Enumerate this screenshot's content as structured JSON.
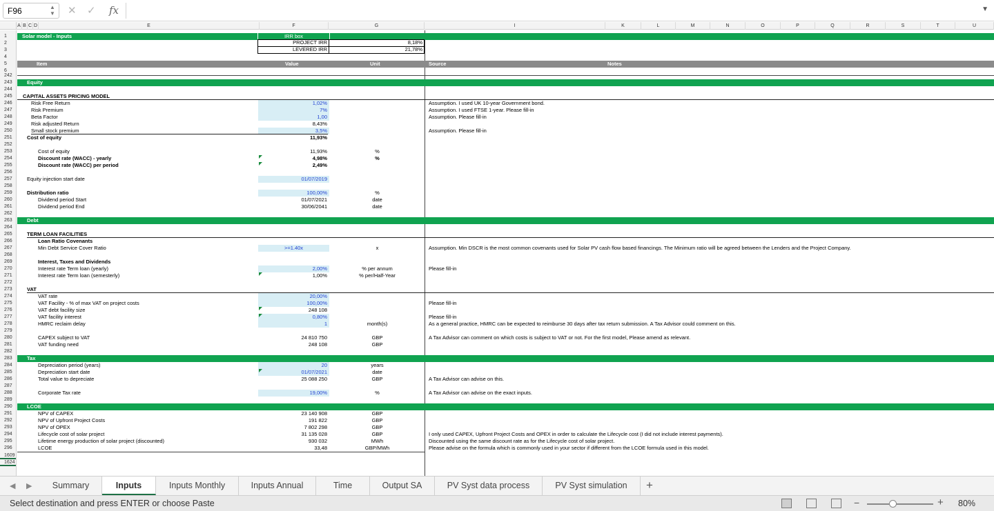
{
  "formula_bar": {
    "name_box": "F96",
    "fx_label": "fx",
    "formula": ""
  },
  "columns": [
    "A",
    "B",
    "C",
    "D",
    "E",
    "F",
    "G",
    "I",
    "K",
    "L",
    "M",
    "N",
    "O",
    "P",
    "Q",
    "R",
    "S",
    "T",
    "U"
  ],
  "row_numbers": [
    "1",
    "2",
    "3",
    "4",
    "5",
    "6",
    "242",
    "243",
    "244",
    "245",
    "246",
    "247",
    "248",
    "249",
    "250",
    "251",
    "252",
    "253",
    "254",
    "255",
    "256",
    "257",
    "258",
    "259",
    "260",
    "261",
    "262",
    "263",
    "264",
    "265",
    "266",
    "267",
    "268",
    "269",
    "270",
    "271",
    "272",
    "273",
    "274",
    "275",
    "276",
    "277",
    "278",
    "279",
    "280",
    "281",
    "282",
    "283",
    "284",
    "285",
    "286",
    "287",
    "288",
    "289",
    "290",
    "291",
    "292",
    "293",
    "294",
    "295",
    "296",
    "1609",
    "1624"
  ],
  "sheet": {
    "title": "Solar model - Inputs",
    "irr_box": {
      "header": "IRR box",
      "project_label": "PROJECT IRR",
      "project_value": "8,18%",
      "levered_label": "LEVERED IRR",
      "levered_value": "21,78%"
    },
    "header_row": {
      "item": "Item",
      "value": "Value",
      "unit": "Unit",
      "source": "Source",
      "notes": "Notes"
    },
    "equity": {
      "band": "Equity",
      "capm_title": "CAPITAL ASSETS PRICING MODEL",
      "rows": [
        {
          "label": "Risk Free Return",
          "value": "1,02%",
          "source": "Assumption. I used UK 10-year Government bond."
        },
        {
          "label": "Risk Premium",
          "value": "7%",
          "source": "Assumption. I used FTSE 1-year. Please fill-in"
        },
        {
          "label": "Beta Factor",
          "value": "1,00",
          "source": "Assumption. Please fill-in"
        },
        {
          "label": "Risk adjusted Return",
          "value": "8,43%",
          "source": ""
        },
        {
          "label": "Small stock premium",
          "value": "3,5%",
          "source": "Assumption. Please fill-in"
        }
      ],
      "cost_of_equity_label": "Cost of equity",
      "cost_of_equity_value": "11,93%",
      "coe2_label": "Cost of equity",
      "coe2_value": "11,93%",
      "coe2_unit": "%",
      "wacc_yearly_label": "Discount rate (WACC) - yearly",
      "wacc_yearly_value": "4,98%",
      "wacc_yearly_unit": "%",
      "wacc_period_label": "Discount rate (WACC) per period",
      "wacc_period_value": "2,49%",
      "injection_label": "Equity injection start date",
      "injection_value": "01/07/2019",
      "dist_label": "Distribution ratio",
      "dist_value": "100,00%",
      "dist_unit": "%",
      "div_start_label": "Dividend period Start",
      "div_start_value": "01/07/2021",
      "div_start_unit": "date",
      "div_end_label": "Dividend period End",
      "div_end_value": "30/06/2041",
      "div_end_unit": "date"
    },
    "debt": {
      "band": "Debt",
      "tlf_title": "TERM LOAN FACILITIES",
      "covenants_title": "Loan Ratio Covenants",
      "dscr_label": "Min Debt Service Cover Ratio",
      "dscr_value": ">=1.40x",
      "dscr_unit": "x",
      "dscr_source": "Assumption. Min DSCR is the most common covenants used for Solar PV cash flow based financings. The Minimum ratio will be agreed between the Lenders and the Project Company.",
      "itd_title": "Interest, Taxes and Dividends",
      "rate_yearly_label": "Interest rate Term loan (yearly)",
      "rate_yearly_value": "2,00%",
      "rate_yearly_unit": "% per annum",
      "rate_yearly_source": "Please fill-in",
      "rate_semi_label": "Interest rate Term loan (semesterly)",
      "rate_semi_value": "1,00%",
      "rate_semi_unit": "% per/Half-Year"
    },
    "vat": {
      "title": "VAT",
      "rows": [
        {
          "label": "VAT rate",
          "value": "20,00%",
          "unit": "",
          "source": ""
        },
        {
          "label": "VAT Facility - % of max VAT on project costs",
          "value": "100,00%",
          "unit": "",
          "source": "Please fill-in"
        },
        {
          "label": "VAT debt facility size",
          "value": "248 108",
          "unit": "",
          "source": ""
        },
        {
          "label": "VAT facility interest",
          "value": "0,80%",
          "unit": "",
          "source": "Please fill-in"
        },
        {
          "label": "HMRC reclaim delay",
          "value": "1",
          "unit": "month(s)",
          "source": "As a general practice, HMRC can be expected to reimburse 30 days after tax return submission. A Tax Advisor could comment on this."
        }
      ],
      "capex_label": "CAPEX subject to VAT",
      "capex_value": "24 810 750",
      "capex_unit": "GBP",
      "capex_source": "A Tax Advisor can comment on which costs is subject to VAT or not. For the first model, Please amend as relevant.",
      "funding_label": "VAT funding need",
      "funding_value": "248 108",
      "funding_unit": "GBP"
    },
    "tax": {
      "band": "Tax",
      "dep_period_label": "Depreciation period (years)",
      "dep_period_value": "20",
      "dep_period_unit": "years",
      "dep_start_label": "Depreciation start date",
      "dep_start_value": "01/07/2021",
      "dep_start_unit": "date",
      "total_label": "Total value to depreciate",
      "total_value": "25 088 250",
      "total_unit": "GBP",
      "total_source": "A Tax Advisor can advise on this.",
      "corp_label": "Corporate Tax rate",
      "corp_value": "19,00%",
      "corp_unit": "%",
      "corp_source": "A Tax Advisor can advise on the exact inputs."
    },
    "lcoe": {
      "band": "LCOE",
      "rows": [
        {
          "label": "NPV of CAPEX",
          "value": "23 140 908",
          "unit": "GBP",
          "source": ""
        },
        {
          "label": "NPV of Upfront Project Costs",
          "value": "191 822",
          "unit": "GBP",
          "source": ""
        },
        {
          "label": "NPV of OPEX",
          "value": "7 802 298",
          "unit": "GBP",
          "source": ""
        },
        {
          "label": "Lifecycle cost of solar project",
          "value": "31 135 028",
          "unit": "GBP",
          "source": "I only used CAPEX, Upfront Project Costs and OPEX in order to calculate the Lifecycle cost (I did not include interest payments)."
        },
        {
          "label": "Lifetime energy production of solar project (discounted)",
          "value": "930 032",
          "unit": "MWh",
          "source": "Discounted using the same discount rate as for the Lifecycle cost of solar project."
        },
        {
          "label": "LCOE",
          "value": "33,48",
          "unit": "GBP/MWh",
          "source": "Please advise on the formula which is commonly used in your sector if different from the LCOE formula used in this model."
        }
      ]
    }
  },
  "tabs": [
    "Summary",
    "Inputs",
    "Inputs Monthly",
    "Inputs Annual",
    "Time",
    "Output SA",
    "PV Syst data process",
    "PV Syst simulation"
  ],
  "active_tab": "Inputs",
  "add_tab_label": "+",
  "status": {
    "text": "Select destination and press ENTER or choose Paste",
    "zoom": "80%",
    "minus": "−",
    "plus": "+"
  }
}
